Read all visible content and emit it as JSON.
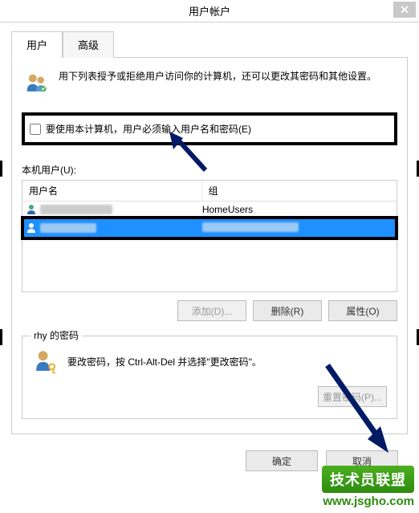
{
  "titlebar": {
    "title": "用户帐户"
  },
  "tabs": {
    "user": "用户",
    "advanced": "高级"
  },
  "info_text": "用下列表授予或拒绝用户访问你的计算机，还可以更改其密码和其他设置。",
  "require_login_label": "要使用本计算机，用户必须输入用户名和密码(E)",
  "users_section_label": "本机用户(U):",
  "table": {
    "col_user": "用户名",
    "col_group": "组",
    "row1_group": "HomeUsers"
  },
  "buttons": {
    "add": "添加(D)...",
    "remove": "删除(R)",
    "properties": "属性(O)"
  },
  "password_group": {
    "legend": "rhy 的密码",
    "text": "要改密码，按 Ctrl-Alt-Del 并选择\"更改密码\"。",
    "reset_btn": "重置密码(P)..."
  },
  "footer": {
    "ok": "确定",
    "cancel": "取消"
  },
  "watermark": {
    "banner": "技术员联盟",
    "url": "www.jsgho.com"
  }
}
